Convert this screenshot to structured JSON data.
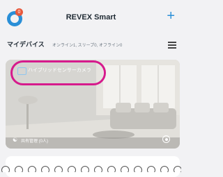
{
  "header": {
    "title": "REVEX Smart",
    "notification_count": "0",
    "add_label": "+"
  },
  "section": {
    "title": "マイデバイス",
    "status": "オンライン1, スリープ0, オフライン0"
  },
  "device_card": {
    "name": "ハイブリッドセンサーカメラ",
    "share_label": "共有管理 (0人)"
  },
  "colors": {
    "accent": "#2a8fd7",
    "highlight": "#d61a8c",
    "notification": "#e85a3d"
  },
  "icons": [
    "avatar-icon",
    "add-icon",
    "menu-icon",
    "camera-icon",
    "share-icon",
    "settings-icon"
  ]
}
